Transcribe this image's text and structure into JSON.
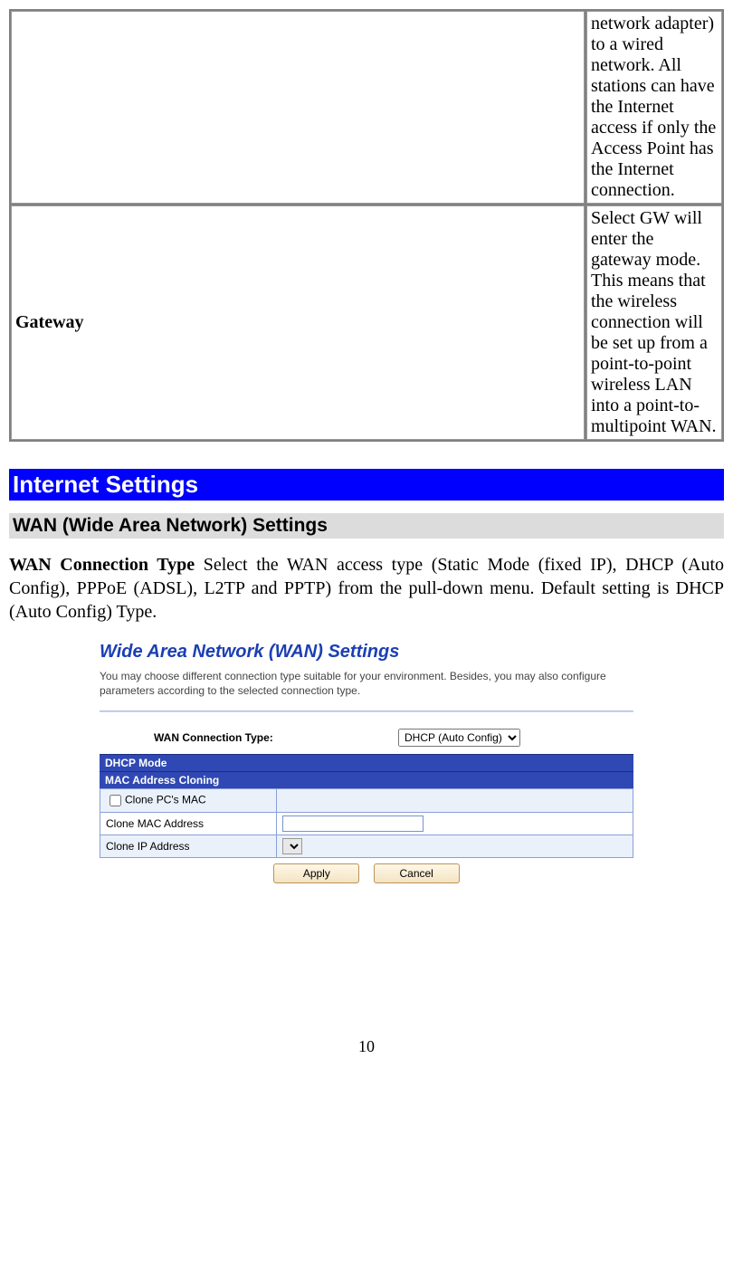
{
  "table": {
    "rows": [
      {
        "label": "",
        "desc": "network adapter) to a wired network. All stations can have the Internet access if only the Access Point has the Internet connection."
      },
      {
        "label": "Gateway",
        "desc": "Select GW will enter the gateway mode. This means that the wireless connection will be set up from a point-to-point wireless LAN into a point-to-multipoint WAN."
      }
    ]
  },
  "headings": {
    "internet_settings": "Internet Settings",
    "wan_settings": "WAN (Wide Area Network) Settings"
  },
  "para": {
    "lead": "WAN Connection Type",
    "rest": " Select the WAN access type (Static Mode (fixed IP), DHCP (Auto Config), PPPoE (ADSL), L2TP and PPTP) from the pull-down menu. Default setting is DHCP (Auto Config) Type."
  },
  "wan_panel": {
    "title": "Wide Area Network (WAN) Settings",
    "intro": "You may choose different connection type suitable for your environment. Besides, you may also configure parameters according to the selected connection type.",
    "conn_label": "WAN Connection Type:",
    "conn_value": "DHCP (Auto Config)",
    "dhcp_mode": "DHCP Mode",
    "mac_cloning": "MAC Address Cloning",
    "clone_pc_mac": "Clone PC's MAC",
    "clone_mac_addr_label": "Clone MAC Address",
    "clone_mac_addr_value": "",
    "clone_ip_addr_label": "Clone IP Address",
    "clone_ip_addr_value": "",
    "apply": "Apply",
    "cancel": "Cancel"
  },
  "page_number": "10"
}
